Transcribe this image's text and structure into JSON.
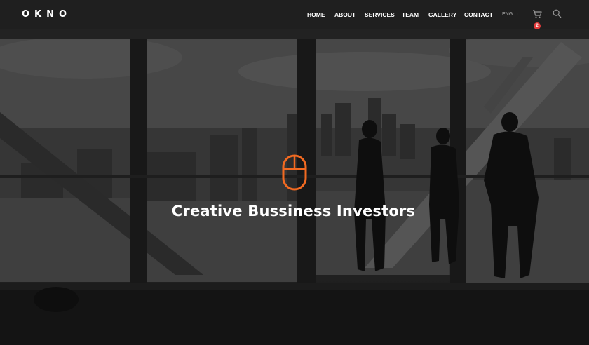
{
  "brand": {
    "logo": "OKNO"
  },
  "nav": {
    "items": [
      {
        "label": "HOME"
      },
      {
        "label": "ABOUT"
      },
      {
        "label": "SERVICES"
      },
      {
        "label": "TEAM"
      },
      {
        "label": "GALLERY"
      },
      {
        "label": "CONTACT"
      }
    ],
    "language": "ENG",
    "language_arrow": "↓",
    "cart_count": "2"
  },
  "hero": {
    "title": "Creative Bussiness Investors",
    "accent_color": "#f26a21"
  },
  "icons": {
    "cart": "shopping-cart-icon",
    "search": "search-icon",
    "scroll": "mouse-scroll-icon"
  }
}
